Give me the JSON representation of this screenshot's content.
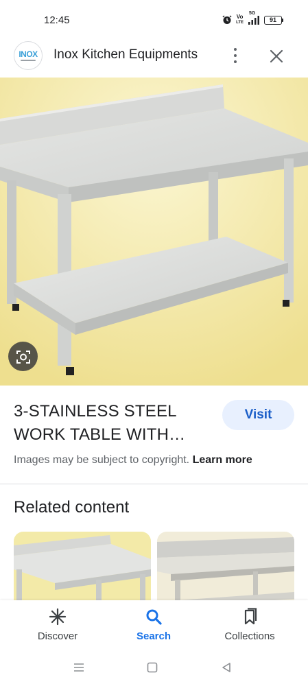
{
  "status_bar": {
    "time": "12:45",
    "volte_top": "Vo",
    "volte_bottom": "LTE",
    "network": "5G",
    "battery": "91"
  },
  "header": {
    "logo_text": "INOX",
    "site_name": "Inox Kitchen Equipments"
  },
  "image": {
    "subject": "stainless steel work table"
  },
  "result": {
    "title_line1": "3-STAINLESS STEEL",
    "title_line2": "WORK TABLE WITH…",
    "visit_label": "Visit",
    "copyright_text": "Images may be subject to copyright.",
    "learn_more_label": "Learn more"
  },
  "related": {
    "heading": "Related content"
  },
  "bottom_nav": {
    "items": [
      {
        "label": "Discover",
        "icon": "asterisk-icon"
      },
      {
        "label": "Search",
        "icon": "search-icon",
        "active": true
      },
      {
        "label": "Collections",
        "icon": "bookmarks-icon"
      }
    ],
    "active_color": "#1a73e8"
  },
  "system_nav": {
    "icons": [
      "menu-icon",
      "home-square-icon",
      "back-triangle-icon"
    ]
  }
}
